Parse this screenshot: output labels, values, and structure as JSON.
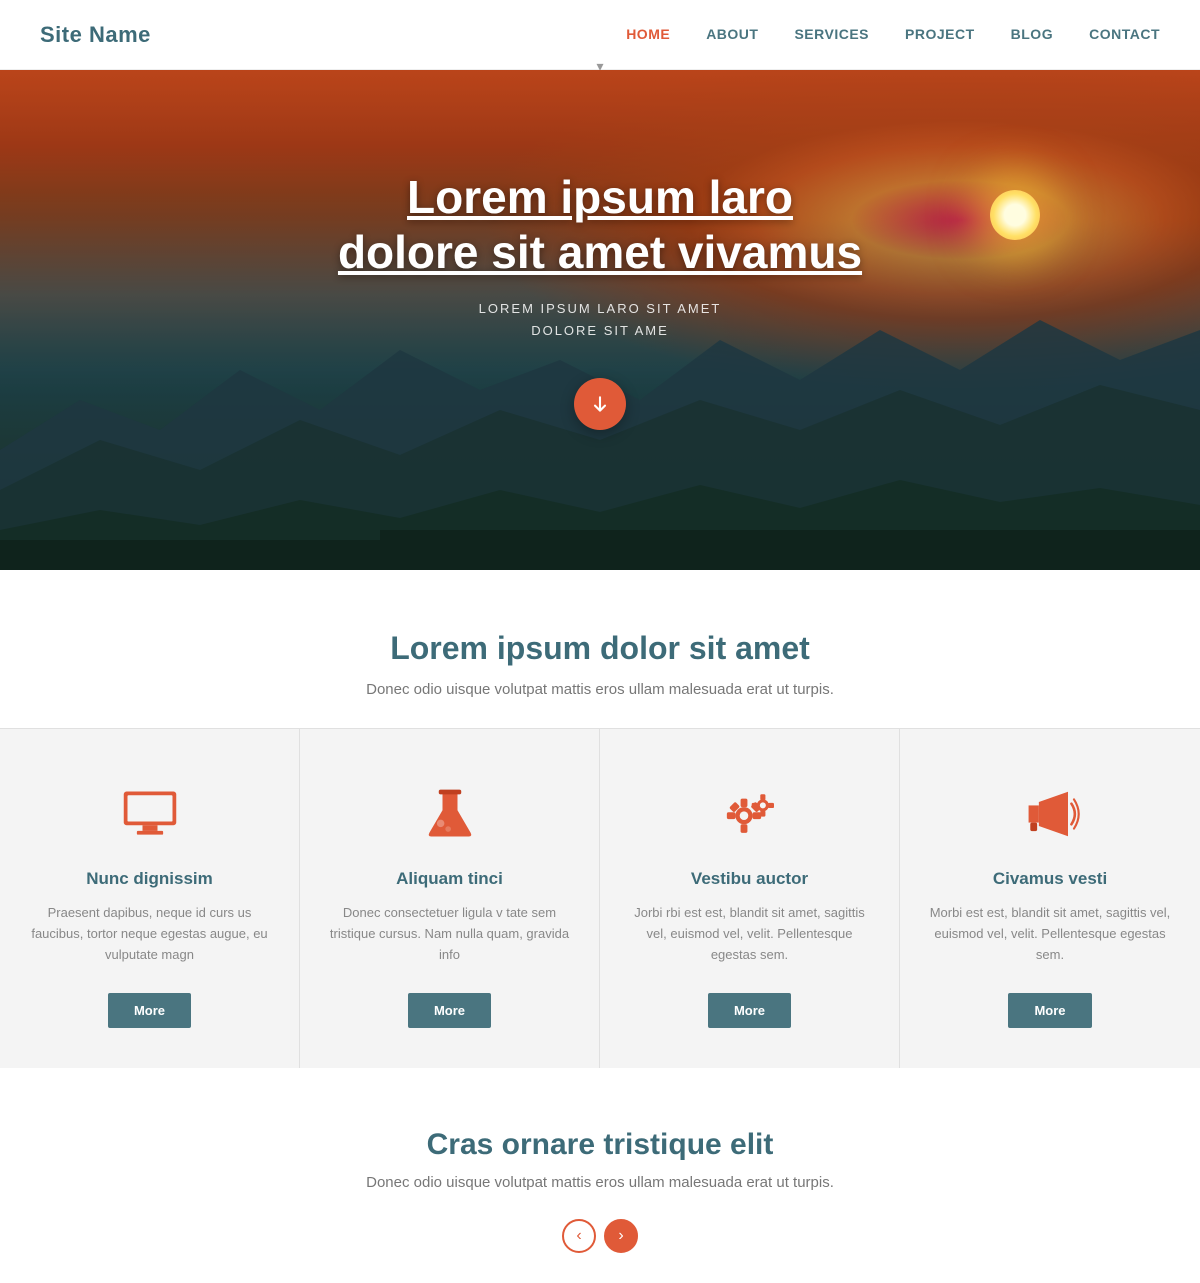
{
  "nav": {
    "site_name": "Site Name",
    "links": [
      {
        "label": "HOME",
        "active": true
      },
      {
        "label": "ABOUT",
        "active": false
      },
      {
        "label": "SERVICES",
        "active": false
      },
      {
        "label": "PROJECT",
        "active": false
      },
      {
        "label": "BLOG",
        "active": false
      },
      {
        "label": "CONTACT",
        "active": false
      }
    ]
  },
  "hero": {
    "title_line1": "Lorem ipsum laro",
    "title_line2": "dolore sit amet vivamus",
    "subtitle_line1": "LOREM IPSUM LARO SIT AMET",
    "subtitle_line2": "DOLORE SIT AME",
    "arrow_label": "↓"
  },
  "section1": {
    "heading": "Lorem ipsum dolor sit amet",
    "body": "Donec odio uisque volutpat mattis eros ullam malesuada erat ut turpis."
  },
  "cards": [
    {
      "icon": "monitor",
      "title": "Nunc dignissim",
      "body": "Praesent dapibus, neque id curs us faucibus, tortor neque egestas augue, eu vulputate magn",
      "button": "More"
    },
    {
      "icon": "flask",
      "title": "Aliquam tinci",
      "body": "Donec consectetuer ligula v tate sem tristique cursus. Nam nulla quam, gravida info",
      "button": "More"
    },
    {
      "icon": "gears",
      "title": "Vestibu auctor",
      "body": "Jorbi rbi est est, blandit sit amet, sagittis vel, euismod vel, velit. Pellentesque egestas sem.",
      "button": "More"
    },
    {
      "icon": "megaphone",
      "title": "Civamus vesti",
      "body": "Morbi est est, blandit sit amet, sagittis vel, euismod vel, velit. Pellentesque egestas sem.",
      "button": "More"
    }
  ],
  "section2": {
    "heading": "Cras ornare tristique elit",
    "body": "Donec odio uisque volutpat mattis eros ullam malesuada erat ut turpis.",
    "prev_label": "‹",
    "next_label": "›"
  }
}
